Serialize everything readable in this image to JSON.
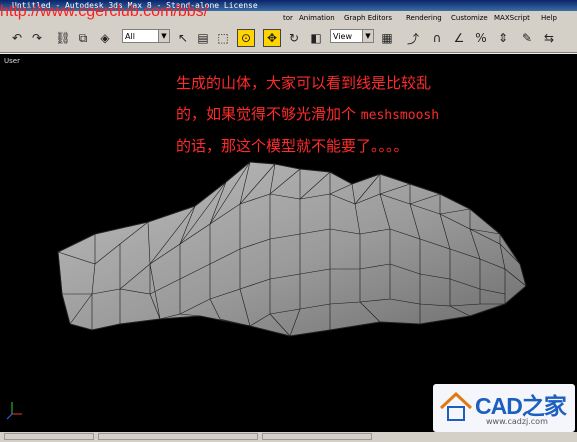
{
  "titlebar": {
    "text": "Untitled - Autodesk 3ds Max 8 - Stand-alone License"
  },
  "watermark": {
    "url": "http://www.cgerclub.com/bbs/"
  },
  "menubar": {
    "items": [
      "Animation",
      "Graph Editors",
      "Rendering",
      "Customize",
      "MAXScript",
      "Help"
    ],
    "partial": "tor"
  },
  "toolbar": {
    "selection_filter": "All",
    "reference_coord": "View"
  },
  "viewport": {
    "label": "User",
    "note_line1": "生成的山体，大家可以看到线是比较乱",
    "note_line2_a": "的，如果觉得不够光滑加个",
    "note_line2_b": "meshsmoosh",
    "note_line3": "的话，那这个模型就不能要了。。。。",
    "note_color": "#ff2a2a",
    "mesh_color": "#9a9a9a"
  },
  "logo": {
    "brand": "CAD之家",
    "url": "www.cadzj.com"
  }
}
